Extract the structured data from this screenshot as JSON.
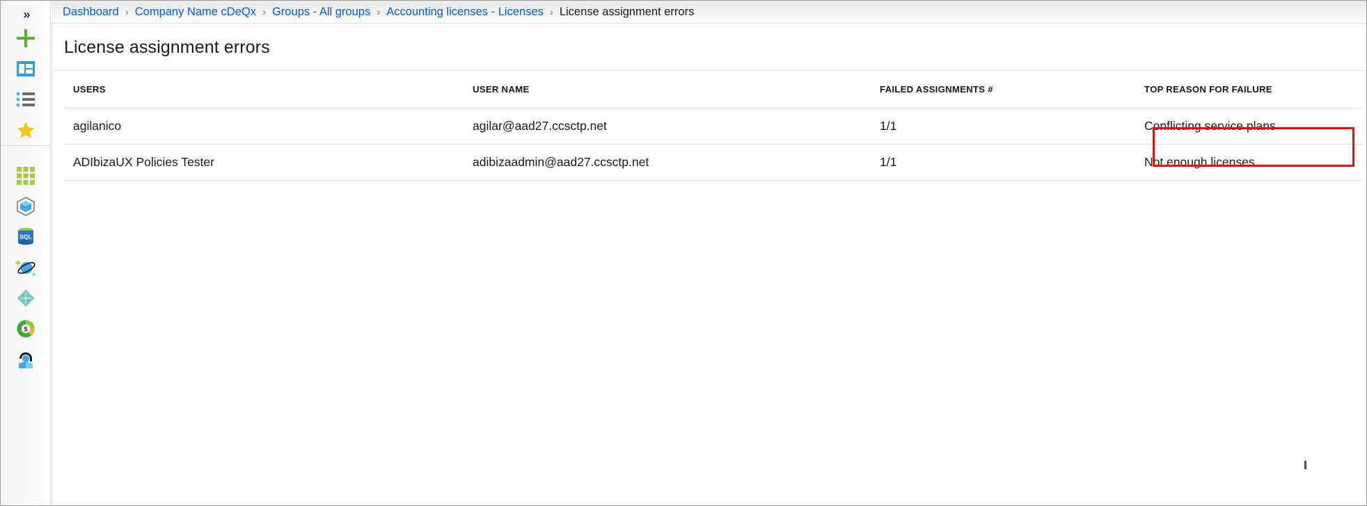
{
  "nav": {
    "collapse_label": "»",
    "collapse_name": "collapse-menu",
    "items": [
      {
        "name": "create-resource-icon",
        "label": "Create a resource"
      },
      {
        "name": "dashboard-icon",
        "label": "Dashboard"
      },
      {
        "name": "all-services-icon",
        "label": "All services"
      },
      {
        "name": "favorites-star-icon",
        "label": "FAVORITES"
      },
      {
        "name": "all-resources-grid-icon",
        "label": "All resources"
      },
      {
        "name": "resource-groups-icon",
        "label": "Resource groups"
      },
      {
        "name": "sql-databases-icon",
        "label": "SQL databases"
      },
      {
        "name": "cosmos-db-icon",
        "label": "Azure Cosmos DB"
      },
      {
        "name": "azure-active-directory-icon",
        "label": "Azure Active Directory"
      },
      {
        "name": "cost-management-icon",
        "label": "Cost Management + Billing"
      },
      {
        "name": "help-support-icon",
        "label": "Help + support"
      }
    ]
  },
  "breadcrumb": {
    "separator": "›",
    "items": [
      {
        "label": "Dashboard",
        "current": false
      },
      {
        "label": "Company Name cDeQx",
        "current": false
      },
      {
        "label": "Groups - All groups",
        "current": false
      },
      {
        "label": "Accounting licenses - Licenses",
        "current": false
      },
      {
        "label": "License assignment errors",
        "current": true
      }
    ]
  },
  "blade": {
    "title": "License assignment errors"
  },
  "table": {
    "columns": [
      {
        "key": "users",
        "label": "USERS"
      },
      {
        "key": "username",
        "label": "USER NAME"
      },
      {
        "key": "failed",
        "label": "FAILED ASSIGNMENTS #"
      },
      {
        "key": "reason",
        "label": "TOP REASON FOR FAILURE"
      }
    ],
    "rows": [
      {
        "users": "agilanico",
        "username": "agilar@aad27.ccsctp.net",
        "failed": "1/1",
        "reason": "Conflicting service plans",
        "highlighted": true
      },
      {
        "users": "ADIbizaUX Policies Tester",
        "username": "adibizaadmin@aad27.ccsctp.net",
        "failed": "1/1",
        "reason": "Not enough licenses",
        "highlighted": false
      }
    ]
  },
  "annotation": {
    "highlight_color": "#e60f0f",
    "highlight_target": "Conflicting service plans"
  },
  "colors": {
    "link": "#015cda",
    "text": "#1a1a1a",
    "border": "#dcdcdc",
    "rail_bg": "#f6f6f6",
    "accent_green": "#5ab02a",
    "accent_blue": "#2a9fd8"
  }
}
